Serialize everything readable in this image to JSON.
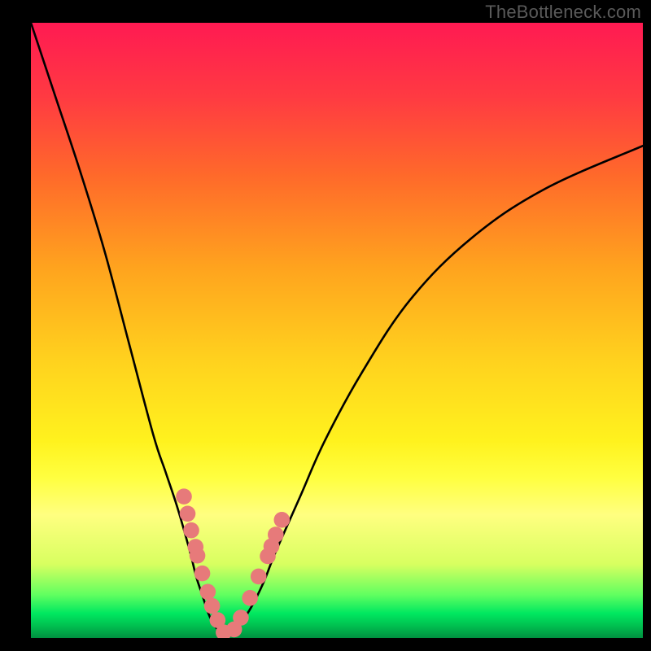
{
  "watermark": "TheBottleneck.com",
  "chart_data": {
    "type": "line",
    "title": "",
    "xlabel": "",
    "ylabel": "",
    "xlim": [
      0,
      100
    ],
    "ylim": [
      0,
      100
    ],
    "legend": false,
    "series": [
      {
        "name": "curve-left",
        "x": [
          0,
          4,
          8,
          12,
          16,
          20,
          22,
          24,
          26,
          27,
          28,
          29,
          30,
          31,
          32
        ],
        "y": [
          100,
          88,
          76,
          63,
          48,
          33,
          27,
          21,
          14,
          10,
          7,
          4,
          2,
          1,
          0
        ]
      },
      {
        "name": "curve-right",
        "x": [
          32,
          33,
          34,
          36,
          38,
          40,
          44,
          48,
          54,
          62,
          72,
          84,
          100
        ],
        "y": [
          0,
          1,
          2,
          5,
          9,
          14,
          23,
          32,
          43,
          55,
          65,
          73,
          80
        ]
      },
      {
        "name": "markers-left",
        "x": [
          25.0,
          25.6,
          26.2,
          26.9,
          27.2,
          28.0,
          28.9,
          29.6,
          30.5,
          31.5
        ],
        "y": [
          23.0,
          20.2,
          17.5,
          14.8,
          13.4,
          10.5,
          7.5,
          5.2,
          2.9,
          0.9
        ]
      },
      {
        "name": "markers-right",
        "x": [
          33.2,
          34.3,
          35.8,
          37.2,
          38.7,
          39.3,
          40.0,
          41.0
        ],
        "y": [
          1.4,
          3.3,
          6.5,
          10.0,
          13.3,
          14.9,
          16.8,
          19.2
        ]
      }
    ],
    "colors": {
      "curve": "#000000",
      "marker_fill": "#e77a7a",
      "marker_stroke": "#c94b4b"
    }
  }
}
